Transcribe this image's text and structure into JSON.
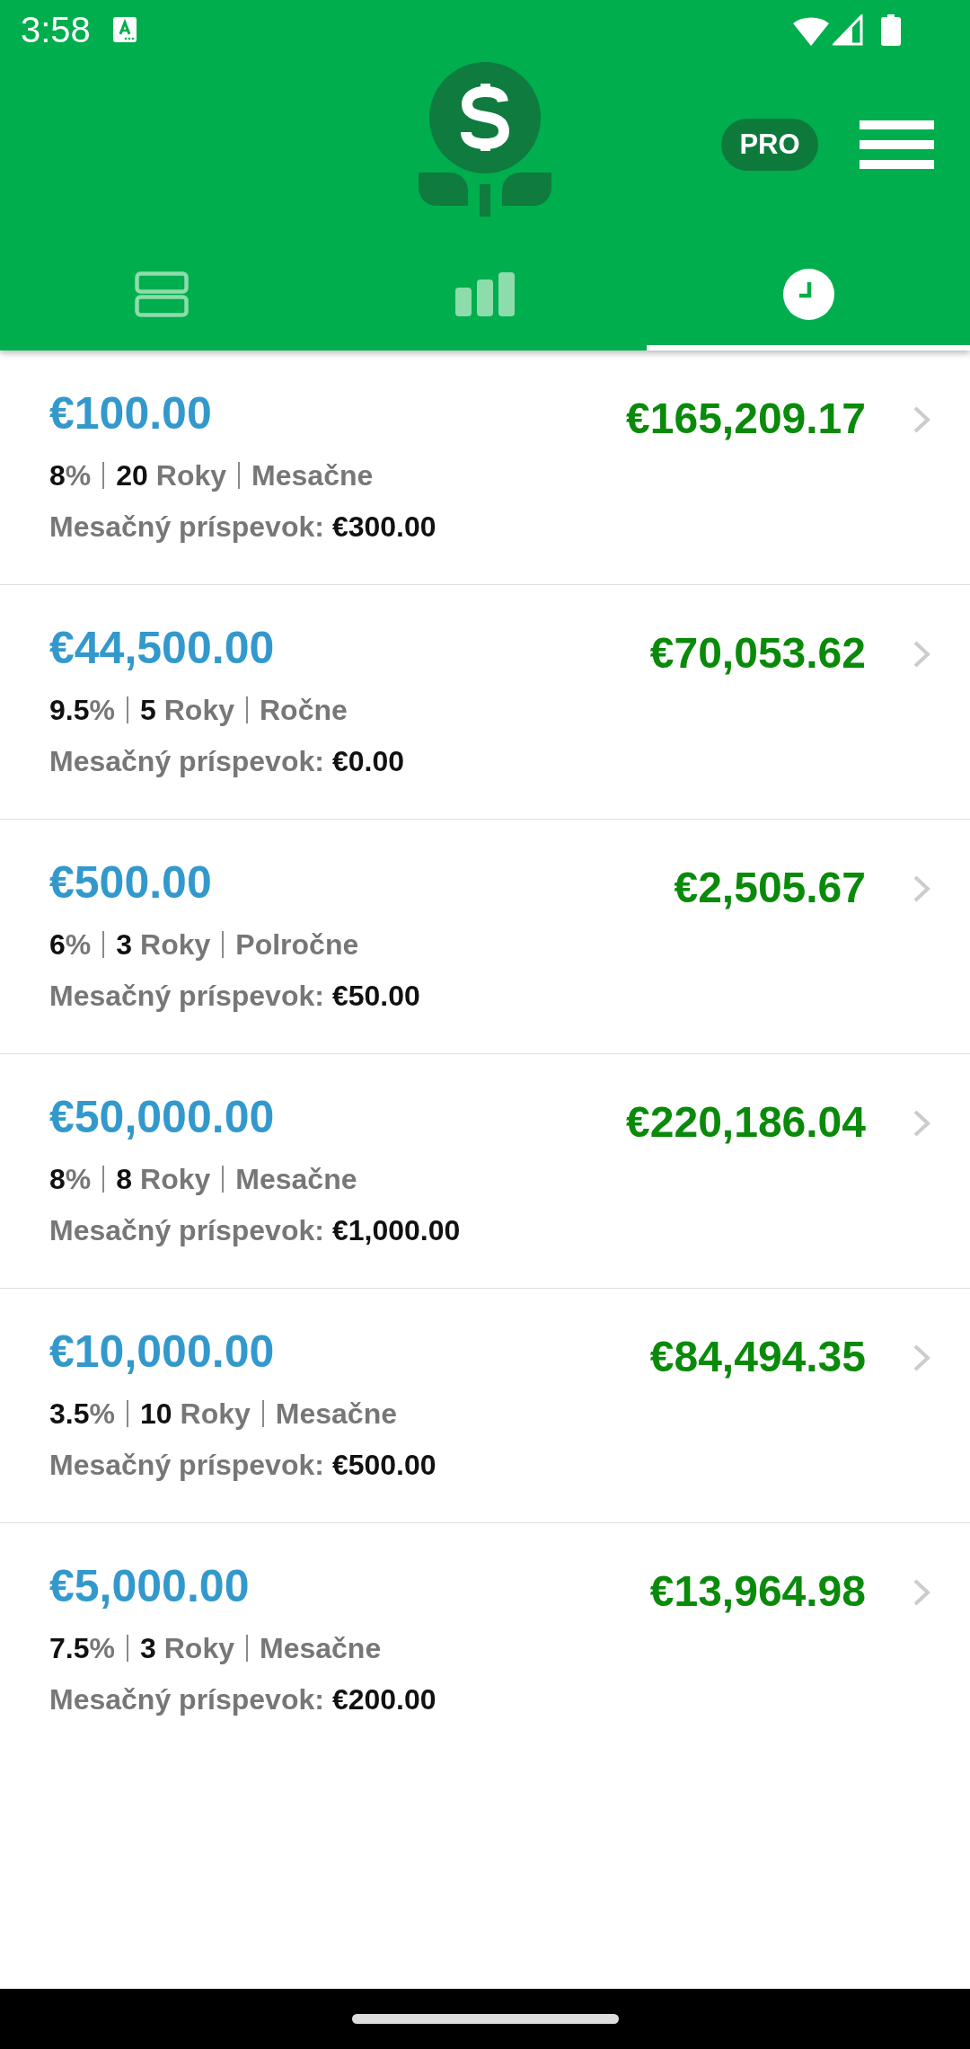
{
  "status_bar": {
    "time": "3:58"
  },
  "header": {
    "pro_badge": "PRO"
  },
  "tabs": [
    {
      "kind": "list",
      "selected": false
    },
    {
      "kind": "chart",
      "selected": false
    },
    {
      "kind": "history",
      "selected": true
    }
  ],
  "history": [
    {
      "principal": "€100.00",
      "result": "€165,209.17",
      "rate": "8",
      "rate_unit": "%",
      "years": "20",
      "years_unit": "Roky",
      "frequency": "Mesačne",
      "contribution_label": "Mesačný príspevok:",
      "contribution": "€300.00"
    },
    {
      "principal": "€44,500.00",
      "result": "€70,053.62",
      "rate": "9.5",
      "rate_unit": "%",
      "years": "5",
      "years_unit": "Roky",
      "frequency": "Ročne",
      "contribution_label": "Mesačný príspevok:",
      "contribution": "€0.00"
    },
    {
      "principal": "€500.00",
      "result": "€2,505.67",
      "rate": "6",
      "rate_unit": "%",
      "years": "3",
      "years_unit": "Roky",
      "frequency": "Polročne",
      "contribution_label": "Mesačný príspevok:",
      "contribution": "€50.00"
    },
    {
      "principal": "€50,000.00",
      "result": "€220,186.04",
      "rate": "8",
      "rate_unit": "%",
      "years": "8",
      "years_unit": "Roky",
      "frequency": "Mesačne",
      "contribution_label": "Mesačný príspevok:",
      "contribution": "€1,000.00"
    },
    {
      "principal": "€10,000.00",
      "result": "€84,494.35",
      "rate": "3.5",
      "rate_unit": "%",
      "years": "10",
      "years_unit": "Roky",
      "frequency": "Mesačne",
      "contribution_label": "Mesačný príspevok:",
      "contribution": "€500.00"
    },
    {
      "principal": "€5,000.00",
      "result": "€13,964.98",
      "rate": "7.5",
      "rate_unit": "%",
      "years": "3",
      "years_unit": "Roky",
      "frequency": "Mesačne",
      "contribution_label": "Mesačný príspevok:",
      "contribution": "€200.00"
    }
  ]
}
